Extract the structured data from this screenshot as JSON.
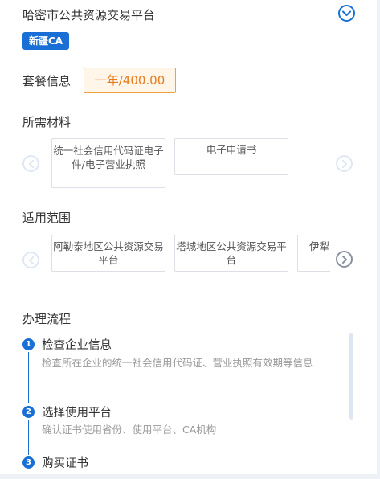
{
  "header": {
    "title": "哈密市公共资源交易平台",
    "badge": "新疆CA",
    "expand_icon": "chevron-down-circle-icon"
  },
  "package": {
    "label": "套餐信息",
    "selected": "一年/400.00"
  },
  "materials": {
    "label": "所需材料",
    "items": [
      "统一社会信用代码证电子件/电子营业执照",
      "电子申请书"
    ]
  },
  "scope": {
    "label": "适用范围",
    "items": [
      "阿勒泰地区公共资源交易平台",
      "塔城地区公共资源交易平台",
      "伊犁"
    ]
  },
  "process": {
    "label": "办理流程",
    "steps": [
      {
        "num": "1",
        "title": "检查企业信息",
        "desc": "检查所在企业的统一社会信用代码证、营业执照有效期等信息"
      },
      {
        "num": "2",
        "title": "选择使用平台",
        "desc": "确认证书使用省份、使用平台、CA机构"
      },
      {
        "num": "3",
        "title": "购买证书",
        "desc": ""
      }
    ]
  },
  "colors": {
    "accent": "#1a6fd6",
    "price_text": "#e87c1e",
    "price_border": "#f0a040"
  }
}
